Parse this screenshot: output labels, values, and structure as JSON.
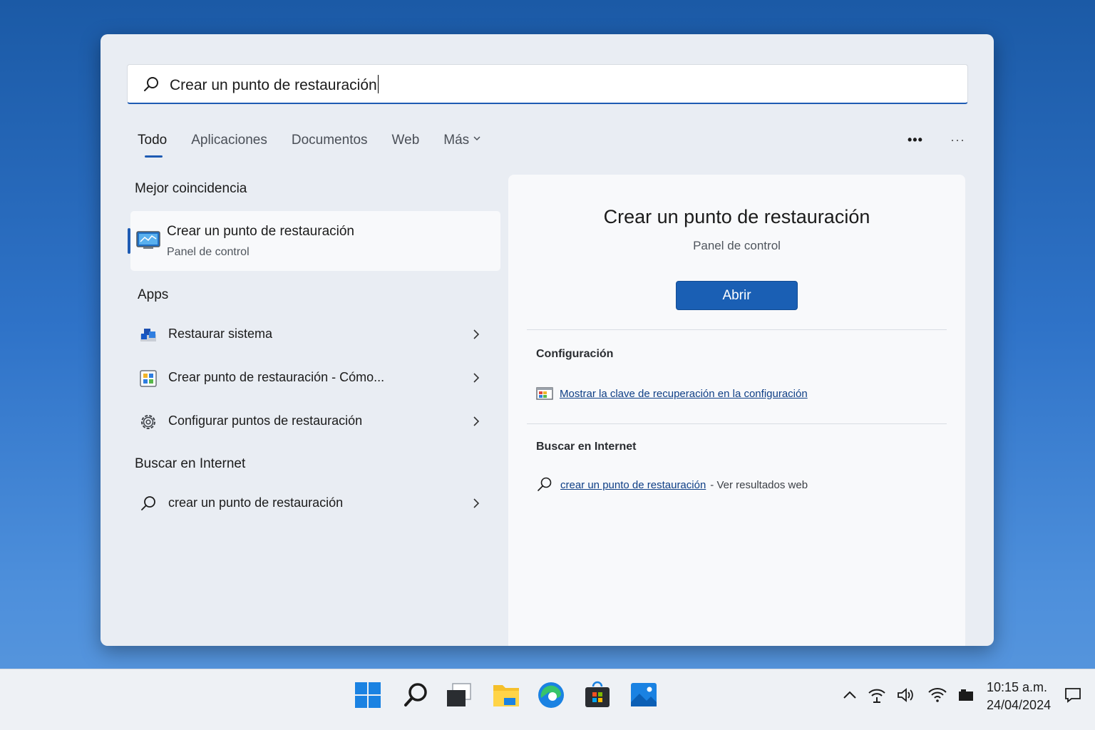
{
  "search": {
    "value": "Crear un punto de restauración"
  },
  "tabs": [
    {
      "label": "Todo"
    },
    {
      "label": "Aplicaciones"
    },
    {
      "label": "Documentos"
    },
    {
      "label": "Web"
    },
    {
      "label": "Más"
    }
  ],
  "left": {
    "best_match_title": "Mejor coincidencia",
    "best_match": {
      "title": "Crear un punto de restauración",
      "subtitle": "Panel de control",
      "icon": "control-panel-icon"
    },
    "apps_title": "Apps",
    "apps": [
      {
        "label": "Restaurar sistema",
        "icon": "system-restore-icon"
      },
      {
        "label": "Crear punto de restauración - Cómo...",
        "icon": "help-page-icon"
      },
      {
        "label": "Configurar puntos de restauración",
        "icon": "gear-icon"
      }
    ],
    "web_title": "Buscar en Internet",
    "web_item": {
      "label": "crear un punto de restauración",
      "icon": "search-icon"
    }
  },
  "preview": {
    "title": "Crear un punto de restauración",
    "subtitle": "Panel de control",
    "open_label": "Abrir",
    "settings_title": "Configuración",
    "settings_link": "Mostrar la clave de recuperación en la configuración",
    "web_title": "Buscar en Internet",
    "web_link": "crear un punto de restauración",
    "web_suffix": "- Ver resultados web"
  },
  "taskbar": {
    "apps": [
      "start-icon",
      "search-icon",
      "task-view-icon",
      "file-explorer-icon",
      "edge-icon",
      "store-icon",
      "photos-icon"
    ],
    "tray": [
      "chevron-up-icon",
      "network-icon",
      "volume-icon",
      "wifi-icon",
      "battery-icon"
    ],
    "time": "10:15 a.m.",
    "date": "24/04/2024"
  },
  "colors": {
    "accent": "#1a5fb4",
    "link": "#0f3f86",
    "window_bg": "#e9edf3",
    "preview_bg": "#f8f9fb"
  }
}
